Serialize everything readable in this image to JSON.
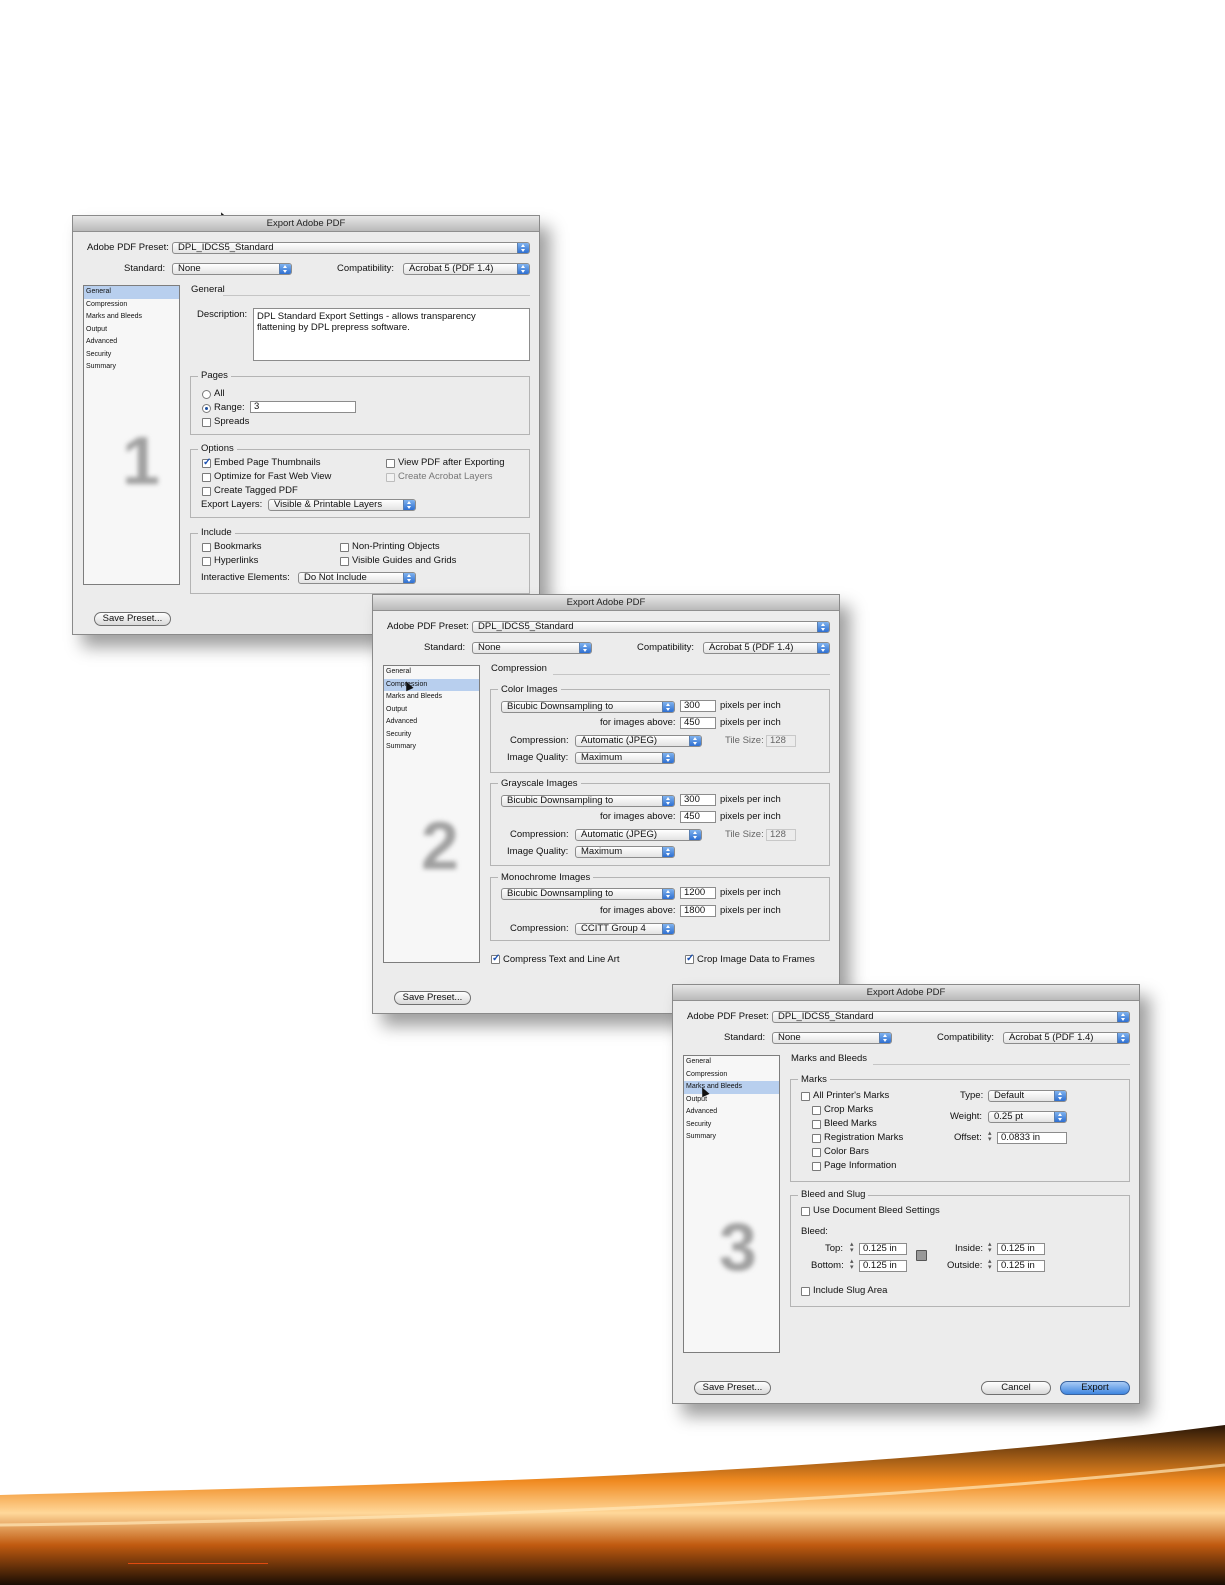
{
  "colors": {
    "accent": "#3f86e0",
    "selection": "#b8cfee",
    "banner": "#f08a20"
  },
  "shared": {
    "title": "Export Adobe PDF",
    "preset_label": "Adobe PDF Preset:",
    "preset_value": "DPL_IDCS5_Standard",
    "standard_label": "Standard:",
    "standard_value": "None",
    "compat_label": "Compatibility:",
    "compat_value": "Acrobat 5 (PDF 1.4)",
    "save_preset": "Save Preset...",
    "sidebar": [
      "General",
      "Compression",
      "Marks and Bleeds",
      "Output",
      "Advanced",
      "Security",
      "Summary"
    ]
  },
  "step_numbers": [
    "1",
    "2",
    "3"
  ],
  "d1": {
    "section": "General",
    "description_label": "Description:",
    "description_text": "DPL Standard Export Settings - allows transparency flattening by DPL prepress software.",
    "pages": {
      "title": "Pages",
      "all": "All",
      "range": "Range:",
      "range_value": "3",
      "spreads": "Spreads"
    },
    "options": {
      "title": "Options",
      "embed_thumbs": "Embed Page Thumbnails",
      "optimize": "Optimize for Fast Web View",
      "tagged": "Create Tagged PDF",
      "view_after": "View PDF after Exporting",
      "acrobat_layers": "Create Acrobat Layers",
      "export_layers_label": "Export Layers:",
      "export_layers_value": "Visible & Printable Layers"
    },
    "include": {
      "title": "Include",
      "bookmarks": "Bookmarks",
      "hyperlinks": "Hyperlinks",
      "nonprinting": "Non-Printing Objects",
      "guides": "Visible Guides and Grids",
      "interactive_label": "Interactive Elements:",
      "interactive_value": "Do Not Include"
    }
  },
  "d2": {
    "section": "Compression",
    "color": {
      "title": "Color Images",
      "method": "Bicubic Downsampling to",
      "ppi": "300",
      "ppi_unit": "pixels per inch",
      "above_label": "for images above:",
      "above": "450",
      "compression_label": "Compression:",
      "compression": "Automatic (JPEG)",
      "tile_label": "Tile Size:",
      "tile": "128",
      "quality_label": "Image Quality:",
      "quality": "Maximum"
    },
    "gray": {
      "title": "Grayscale Images",
      "method": "Bicubic Downsampling to",
      "ppi": "300",
      "ppi_unit": "pixels per inch",
      "above_label": "for images above:",
      "above": "450",
      "compression_label": "Compression:",
      "compression": "Automatic (JPEG)",
      "tile_label": "Tile Size:",
      "tile": "128",
      "quality_label": "Image Quality:",
      "quality": "Maximum"
    },
    "mono": {
      "title": "Monochrome Images",
      "method": "Bicubic Downsampling to",
      "ppi": "1200",
      "ppi_unit": "pixels per inch",
      "above_label": "for images above:",
      "above": "1800",
      "compression_label": "Compression:",
      "compression": "CCITT Group 4"
    },
    "compress_text": "Compress Text and Line Art",
    "crop_image": "Crop Image Data to Frames"
  },
  "d3": {
    "section": "Marks and Bleeds",
    "marks": {
      "title": "Marks",
      "all": "All Printer's Marks",
      "crop": "Crop Marks",
      "bleed": "Bleed Marks",
      "registration": "Registration Marks",
      "colorbars": "Color Bars",
      "pageinfo": "Page Information",
      "type_label": "Type:",
      "type_value": "Default",
      "weight_label": "Weight:",
      "weight_value": "0.25 pt",
      "offset_label": "Offset:",
      "offset_value": "0.0833 in"
    },
    "bleed": {
      "title": "Bleed and Slug",
      "use_doc": "Use Document Bleed Settings",
      "bleed_label": "Bleed:",
      "top_label": "Top:",
      "top": "0.125 in",
      "bottom_label": "Bottom:",
      "bottom": "0.125 in",
      "inside_label": "Inside:",
      "inside": "0.125 in",
      "outside_label": "Outside:",
      "outside": "0.125 in",
      "slug": "Include Slug Area"
    },
    "cancel": "Cancel",
    "export": "Export"
  }
}
